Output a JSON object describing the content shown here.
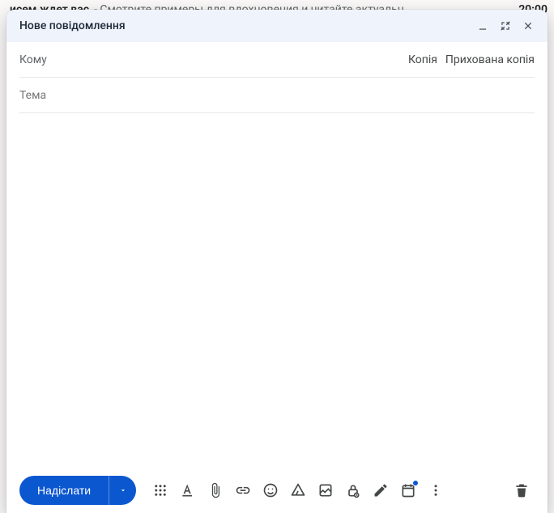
{
  "background": {
    "title": "исем ждет вас",
    "snippet": "Смотрите примеры для вдохновения и читайте актуальн…",
    "time": "20:00"
  },
  "compose": {
    "title": "Нове повідомлення"
  },
  "fields": {
    "to_label": "Кому",
    "cc_label": "Копія",
    "bcc_label": "Прихована копія",
    "subject_placeholder": "Тема"
  },
  "toolbar": {
    "send_label": "Надіслати"
  }
}
